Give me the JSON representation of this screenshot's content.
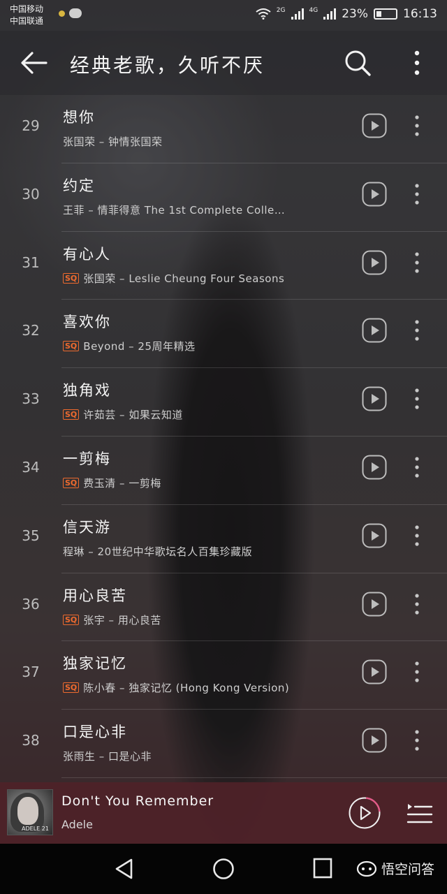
{
  "status_bar": {
    "carrier_1": "中国移动",
    "carrier_2": "中国联通",
    "net_2g": "2G",
    "net_4g": "4G",
    "battery": "23%",
    "time": "16:13"
  },
  "header": {
    "title": "经典老歌，久听不厌",
    "icons": [
      "back-arrow-icon",
      "search-icon",
      "more-vertical-icon"
    ]
  },
  "songs": [
    {
      "num": "29",
      "title": "想你",
      "meta": "张国荣 – 钟情张国荣",
      "sq": false
    },
    {
      "num": "30",
      "title": "约定",
      "meta": "王菲 – 情菲得意 The 1st Complete Colle…",
      "sq": false
    },
    {
      "num": "31",
      "title": "有心人",
      "meta": "张国荣 – Leslie Cheung Four Seasons",
      "sq": true
    },
    {
      "num": "32",
      "title": "喜欢你",
      "meta": "Beyond – 25周年精选",
      "sq": true
    },
    {
      "num": "33",
      "title": "独角戏",
      "meta": "许茹芸 – 如果云知道",
      "sq": true
    },
    {
      "num": "34",
      "title": "一剪梅",
      "meta": "费玉清 – 一剪梅",
      "sq": true
    },
    {
      "num": "35",
      "title": "信天游",
      "meta": "程琳 – 20世纪中华歌坛名人百集珍藏版",
      "sq": false
    },
    {
      "num": "36",
      "title": "用心良苦",
      "meta": "张宇 – 用心良苦",
      "sq": true
    },
    {
      "num": "37",
      "title": "独家记忆",
      "meta": "陈小春 – 独家记忆 (Hong Kong Version)",
      "sq": true
    },
    {
      "num": "38",
      "title": "口是心非",
      "meta": "张雨生 – 口是心非",
      "sq": false
    }
  ],
  "sq_badge": "SQ",
  "player": {
    "title": "Don't You Remember",
    "artist": "Adele",
    "cover_text": "ADELE 21"
  },
  "watermark": "悟空问答",
  "colors": {
    "sq_orange": "#ee6a2e",
    "player_bg": "#4e2228",
    "play_ring_pink": "#e35a88"
  }
}
